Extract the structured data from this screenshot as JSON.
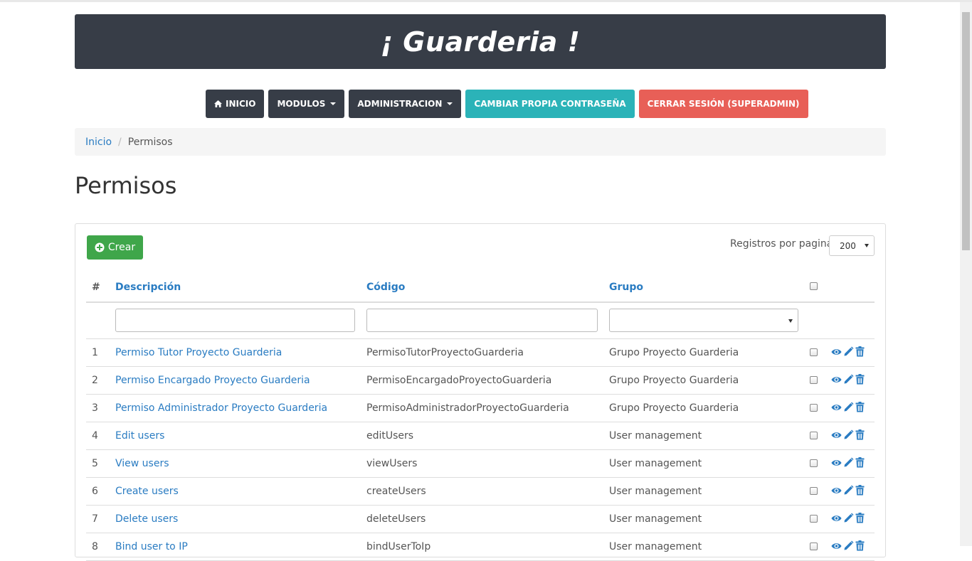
{
  "header": {
    "title": "¡ Guarderia !"
  },
  "nav": {
    "inicio": "INICIO",
    "modulos": "MODULOS",
    "administracion": "ADMINISTRACION",
    "cambiar": "CAMBIAR PROPIA CONTRASEÑA",
    "cerrar": "CERRAR SESIÓN (SUPERADMIN)"
  },
  "breadcrumb": {
    "home": "Inicio",
    "current": "Permisos"
  },
  "page": {
    "title": "Permisos"
  },
  "toolbar": {
    "crear_label": "Crear",
    "per_page_label": "Registros por pagina",
    "per_page_value": "200"
  },
  "table": {
    "headers": {
      "num": "#",
      "descripcion": "Descripción",
      "codigo": "Código",
      "grupo": "Grupo"
    },
    "rows": [
      {
        "num": "1",
        "descripcion": "Permiso Tutor Proyecto Guarderia",
        "codigo": "PermisoTutorProyectoGuarderia",
        "grupo": "Grupo Proyecto Guarderia"
      },
      {
        "num": "2",
        "descripcion": "Permiso Encargado Proyecto Guarderia",
        "codigo": "PermisoEncargadoProyectoGuarderia",
        "grupo": "Grupo Proyecto Guarderia"
      },
      {
        "num": "3",
        "descripcion": "Permiso Administrador Proyecto Guarderia",
        "codigo": "PermisoAdministradorProyectoGuarderia",
        "grupo": "Grupo Proyecto Guarderia"
      },
      {
        "num": "4",
        "descripcion": "Edit users",
        "codigo": "editUsers",
        "grupo": "User management"
      },
      {
        "num": "5",
        "descripcion": "View users",
        "codigo": "viewUsers",
        "grupo": "User management"
      },
      {
        "num": "6",
        "descripcion": "Create users",
        "codigo": "createUsers",
        "grupo": "User management"
      },
      {
        "num": "7",
        "descripcion": "Delete users",
        "codigo": "deleteUsers",
        "grupo": "User management"
      },
      {
        "num": "8",
        "descripcion": "Bind user to IP",
        "codigo": "bindUserToIp",
        "grupo": "User management"
      }
    ]
  },
  "colors": {
    "header": "#373d47",
    "teal": "#2bb3b8",
    "red": "#e85f57",
    "green": "#3fa64a",
    "link": "#2a7cc2"
  },
  "icons": {
    "row_actions": [
      "eye-icon",
      "pencil-icon",
      "trash-icon"
    ],
    "nav_home": "home-icon",
    "crear": "plus-circle-icon"
  }
}
